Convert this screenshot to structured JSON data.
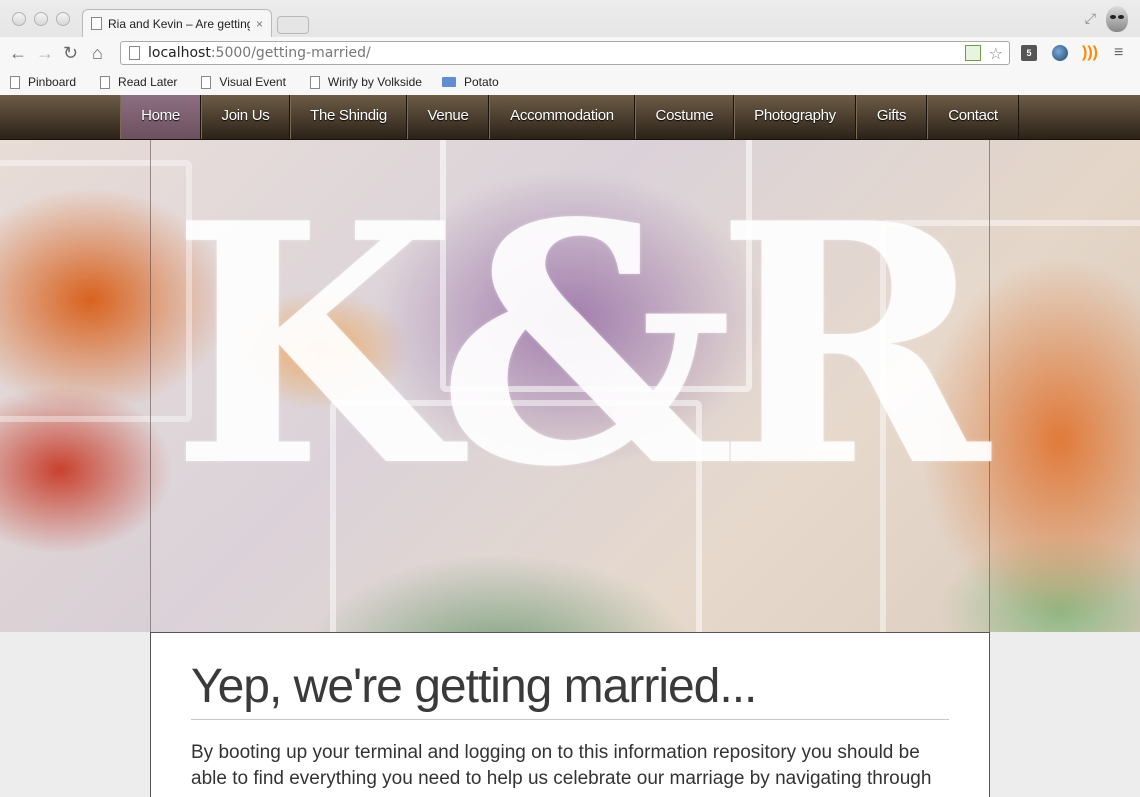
{
  "browser": {
    "tab_title": "Ria and Kevin – Are getting",
    "tab_close": "×",
    "url_host": "localhost",
    "url_path": ":5000/getting-married/",
    "back_glyph": "←",
    "forward_glyph": "→",
    "reload_glyph": "↻",
    "home_glyph": "⌂",
    "star_glyph": "☆",
    "menu_glyph": "≡",
    "rss_glyph": ")))",
    "html5_label": "5",
    "fullscreen_glyph": "⤢"
  },
  "bookmarks": [
    {
      "label": "Pinboard",
      "icon": "page-icon"
    },
    {
      "label": "Read Later",
      "icon": "page-icon"
    },
    {
      "label": "Visual Event",
      "icon": "page-icon"
    },
    {
      "label": "Wirify by Volkside",
      "icon": "page-icon"
    },
    {
      "label": "Potato",
      "icon": "folder-icon"
    }
  ],
  "nav": {
    "items": [
      {
        "label": "Home",
        "active": true
      },
      {
        "label": "Join Us"
      },
      {
        "label": "The Shindig"
      },
      {
        "label": "Venue"
      },
      {
        "label": "Accommodation"
      },
      {
        "label": "Costume"
      },
      {
        "label": "Photography"
      },
      {
        "label": "Gifts"
      },
      {
        "label": "Contact"
      }
    ]
  },
  "hero": {
    "logo": "K&R"
  },
  "content": {
    "heading": "Yep, we're getting married...",
    "intro": "By booting up your terminal and logging on to this information repository you should be able to find everything you need to help us celebrate our marriage by navigating through"
  },
  "colors": {
    "nav_dark": "#2b2218",
    "nav_active": "#7c5f70",
    "heading": "#3a3a3a"
  }
}
